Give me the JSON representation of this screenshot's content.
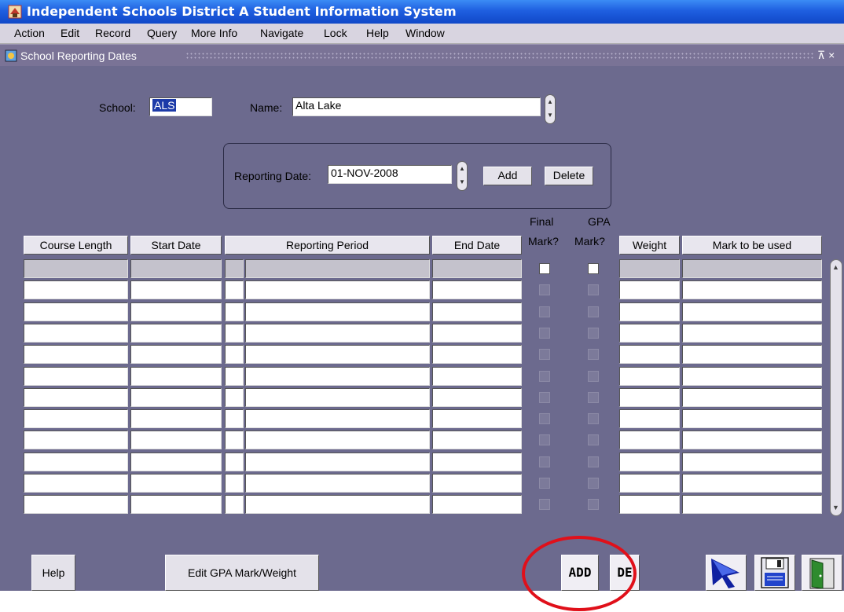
{
  "app": {
    "title": "Independent Schools District A Student Information System"
  },
  "menu": [
    "Action",
    "Edit",
    "Record",
    "Query",
    "More Info",
    "Navigate",
    "Lock",
    "Help",
    "Window"
  ],
  "window": {
    "title": "School Reporting Dates",
    "ctrl": "⊼ ×"
  },
  "school": {
    "label": "School:",
    "value": "ALS"
  },
  "name": {
    "label": "Name:",
    "value": "Alta Lake"
  },
  "reporting": {
    "label": "Reporting Date:",
    "value": "01-NOV-2008",
    "add_label": "Add",
    "delete_label": "Delete"
  },
  "columns": {
    "course_length": "Course Length",
    "start_date": "Start Date",
    "reporting_period": "Reporting Period",
    "end_date": "End Date",
    "final_mark_1": "Final",
    "final_mark_2": "Mark?",
    "gpa_mark_1": "GPA",
    "gpa_mark_2": "Mark?",
    "weight": "Weight",
    "mark_to_be_used": "Mark to be used"
  },
  "rows_count_visible": 12,
  "footer": {
    "help_label": "Help",
    "edit_gpa_label": "Edit GPA Mark/Weight",
    "add_label": "ADD",
    "del_label": "DE"
  },
  "colors": {
    "form_bg": "#6c6a8e",
    "title_bar": "#1f5fe0",
    "annotation": "#e0101a"
  }
}
